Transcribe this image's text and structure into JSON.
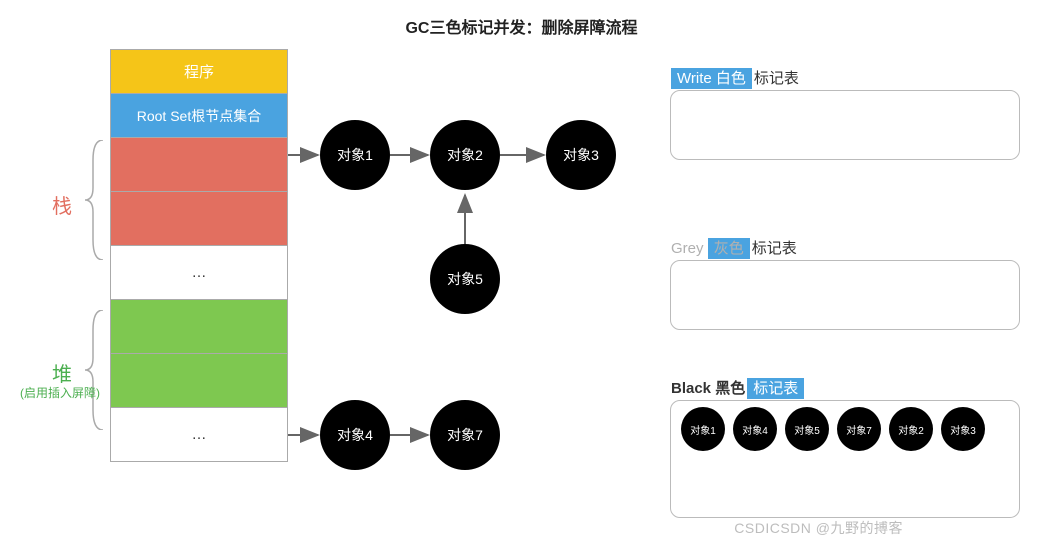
{
  "title": "GC三色标记并发：删除屏障流程",
  "memory": {
    "header": "程序",
    "root": "Root Set根节点集合",
    "ellipsis": "…"
  },
  "labels": {
    "stack": "栈",
    "heap": "堆",
    "heap_note": "(启用插入屏障)"
  },
  "nodes": {
    "obj1": "对象1",
    "obj2": "对象2",
    "obj3": "对象3",
    "obj4": "对象4",
    "obj5": "对象5",
    "obj7": "对象7"
  },
  "panels": {
    "white_title_hl": "Write 白色",
    "white_title_rest": "标记表",
    "grey_title_pre": "Grey ",
    "grey_title_mid": "灰色",
    "grey_title_rest": "标记表",
    "black_title_pre": "Black 黑色",
    "black_title_rest": "标记表",
    "black_items": {
      "b1": "对象1",
      "b2": "对象4",
      "b3": "对象5",
      "b4": "对象7",
      "b5": "对象2",
      "b6": "对象3"
    }
  },
  "watermark": "CSDICSDN @九野的搏客"
}
